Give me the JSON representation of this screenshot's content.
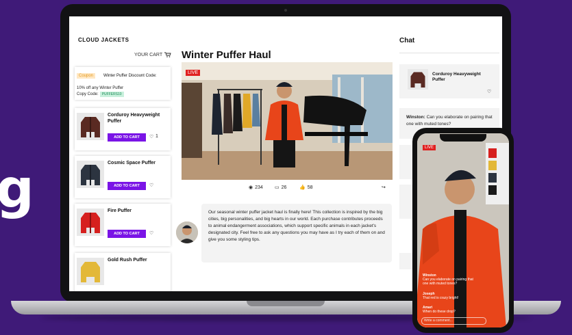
{
  "headline_fragment": "g",
  "store": {
    "brand": "CLOUD JACKETS",
    "cart_label": "YOUR CART",
    "title": "Winter Puffer Haul"
  },
  "coupon": {
    "badge": "Coupon",
    "title": "Winter Puffer Discount Code:",
    "description": "10% off any Winter Puffer",
    "copy_label": "Copy Code:",
    "code": "PUFFERS10"
  },
  "products": [
    {
      "name": "Corduroy Heavyweight Puffer",
      "button": "ADD TO CART",
      "likes": "1",
      "color": "#5a2a22"
    },
    {
      "name": "Cosmic Space Puffer",
      "button": "ADD TO CART",
      "likes": "",
      "color": "#2c3440"
    },
    {
      "name": "Fire Puffer",
      "button": "ADD TO CART",
      "likes": "",
      "color": "#d6201e"
    },
    {
      "name": "Gold Rush Puffer",
      "button": "",
      "likes": "",
      "color": "#e3b838"
    }
  ],
  "video": {
    "live_label": "LIVE",
    "views": "234",
    "comments": "26",
    "likes": "58"
  },
  "description": "Our seasonal winter puffer jacket haul is finally here! This collection is inspired by the big cities, big personalities, and big hearts in our world. Each purchase contributes proceeds to animal endangerment associations, which support specific animals in each jacket's designated city. Feel free to ask any questions you may have as I try each of them on and give you some styling tips.",
  "chat": {
    "title": "Chat",
    "featured_product": "Corduroy Heavyweight Puffer",
    "first_message_author": "Winston:",
    "first_message_text": "Can you elaborate on pairing that one with muted tones?"
  },
  "phone": {
    "live_label": "LIVE",
    "messages": [
      {
        "author": "Winston",
        "text": "Can you elaborate on pairing that one with muted tones?"
      },
      {
        "author": "Joseph",
        "text": "That red is crazy bright!"
      },
      {
        "author": "Amari",
        "text": "When do these drop?"
      }
    ],
    "input_placeholder": "Write a comment..."
  },
  "colors": {
    "background": "#3f1a78",
    "accent": "#7a14e6",
    "live": "#e02020",
    "jacket": "#e8451a"
  }
}
